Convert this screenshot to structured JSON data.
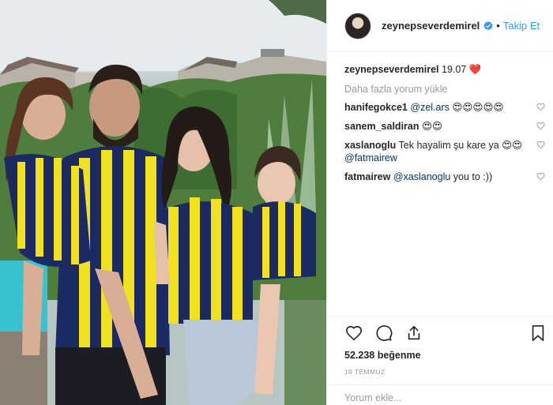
{
  "post": {
    "username": "zeynepseverdemirel",
    "follow_label": "Takip Et",
    "separator": "•",
    "caption_username": "zeynepseverdemirel",
    "caption_text": "19.07 ❤️",
    "load_more": "Daha fazla yorum yükle",
    "comments": [
      {
        "user": "hanifegokce1",
        "mention": "@zel.ars",
        "text": " 😍😍😍😍😍"
      },
      {
        "user": "sanem_saldiran",
        "mention": "",
        "text": "😍😍"
      },
      {
        "user": "xaslanoglu",
        "mention": "@fatmairew",
        "text": "Tek hayalim şu kare ya 😍😍 "
      },
      {
        "user": "fatmairew",
        "mention": "@xaslanoglu",
        "text": " you to :))"
      }
    ],
    "likes": "52.238 beğenme",
    "date": "19 TEMMUZ",
    "comment_placeholder": "Yorum ekle..."
  },
  "colors": {
    "accent": "#3897f0",
    "mention": "#003569",
    "muted": "#999999",
    "text": "#262626",
    "jersey_navy": "#1b2a63",
    "jersey_yellow": "#f2e11e"
  },
  "icons": [
    "verified-badge-icon",
    "heart-icon",
    "comment-icon",
    "share-icon",
    "bookmark-icon"
  ]
}
